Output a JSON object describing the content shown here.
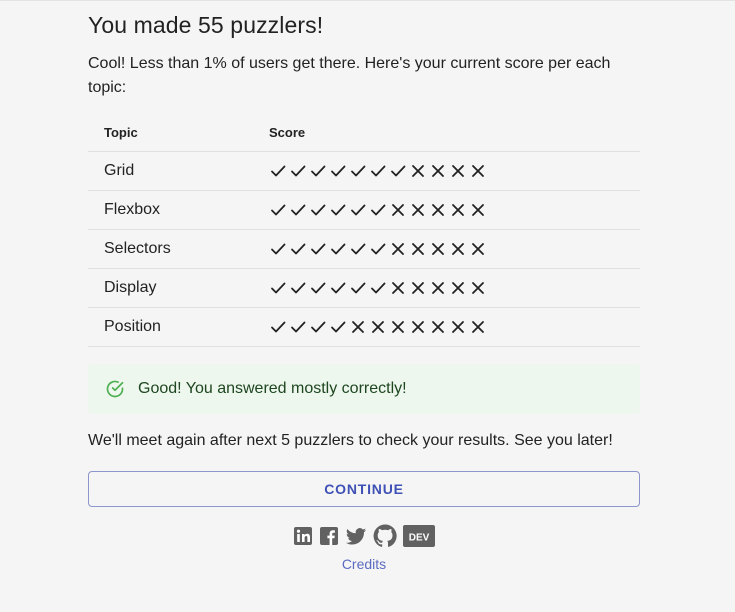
{
  "heading": "You made 55 puzzlers!",
  "intro": "Cool! Less than 1% of users get there. Here's your current score per each topic:",
  "table": {
    "col_topic": "Topic",
    "col_score": "Score",
    "rows": [
      {
        "topic": "Grid",
        "score": [
          1,
          1,
          1,
          1,
          1,
          1,
          1,
          0,
          0,
          0,
          0
        ]
      },
      {
        "topic": "Flexbox",
        "score": [
          1,
          1,
          1,
          1,
          1,
          1,
          0,
          0,
          0,
          0,
          0
        ]
      },
      {
        "topic": "Selectors",
        "score": [
          1,
          1,
          1,
          1,
          1,
          1,
          0,
          0,
          0,
          0,
          0
        ]
      },
      {
        "topic": "Display",
        "score": [
          1,
          1,
          1,
          1,
          1,
          1,
          0,
          0,
          0,
          0,
          0
        ]
      },
      {
        "topic": "Position",
        "score": [
          1,
          1,
          1,
          1,
          0,
          0,
          0,
          0,
          0,
          0,
          0
        ]
      }
    ]
  },
  "alert": {
    "message": "Good! You answered mostly correctly!",
    "icon": "check-circle-icon",
    "color": "#4caf50"
  },
  "followup": "We'll meet again after next 5 puzzlers to check your results. See you later!",
  "continue_label": "CONTINUE",
  "social": [
    "linkedin-icon",
    "facebook-icon",
    "twitter-icon",
    "github-icon",
    "dev-icon"
  ],
  "dev_label": "DEV",
  "credits_label": "Credits",
  "colors": {
    "accent": "#3f51b5",
    "icon_gray": "#757575",
    "success_bg": "#edf7ed"
  }
}
